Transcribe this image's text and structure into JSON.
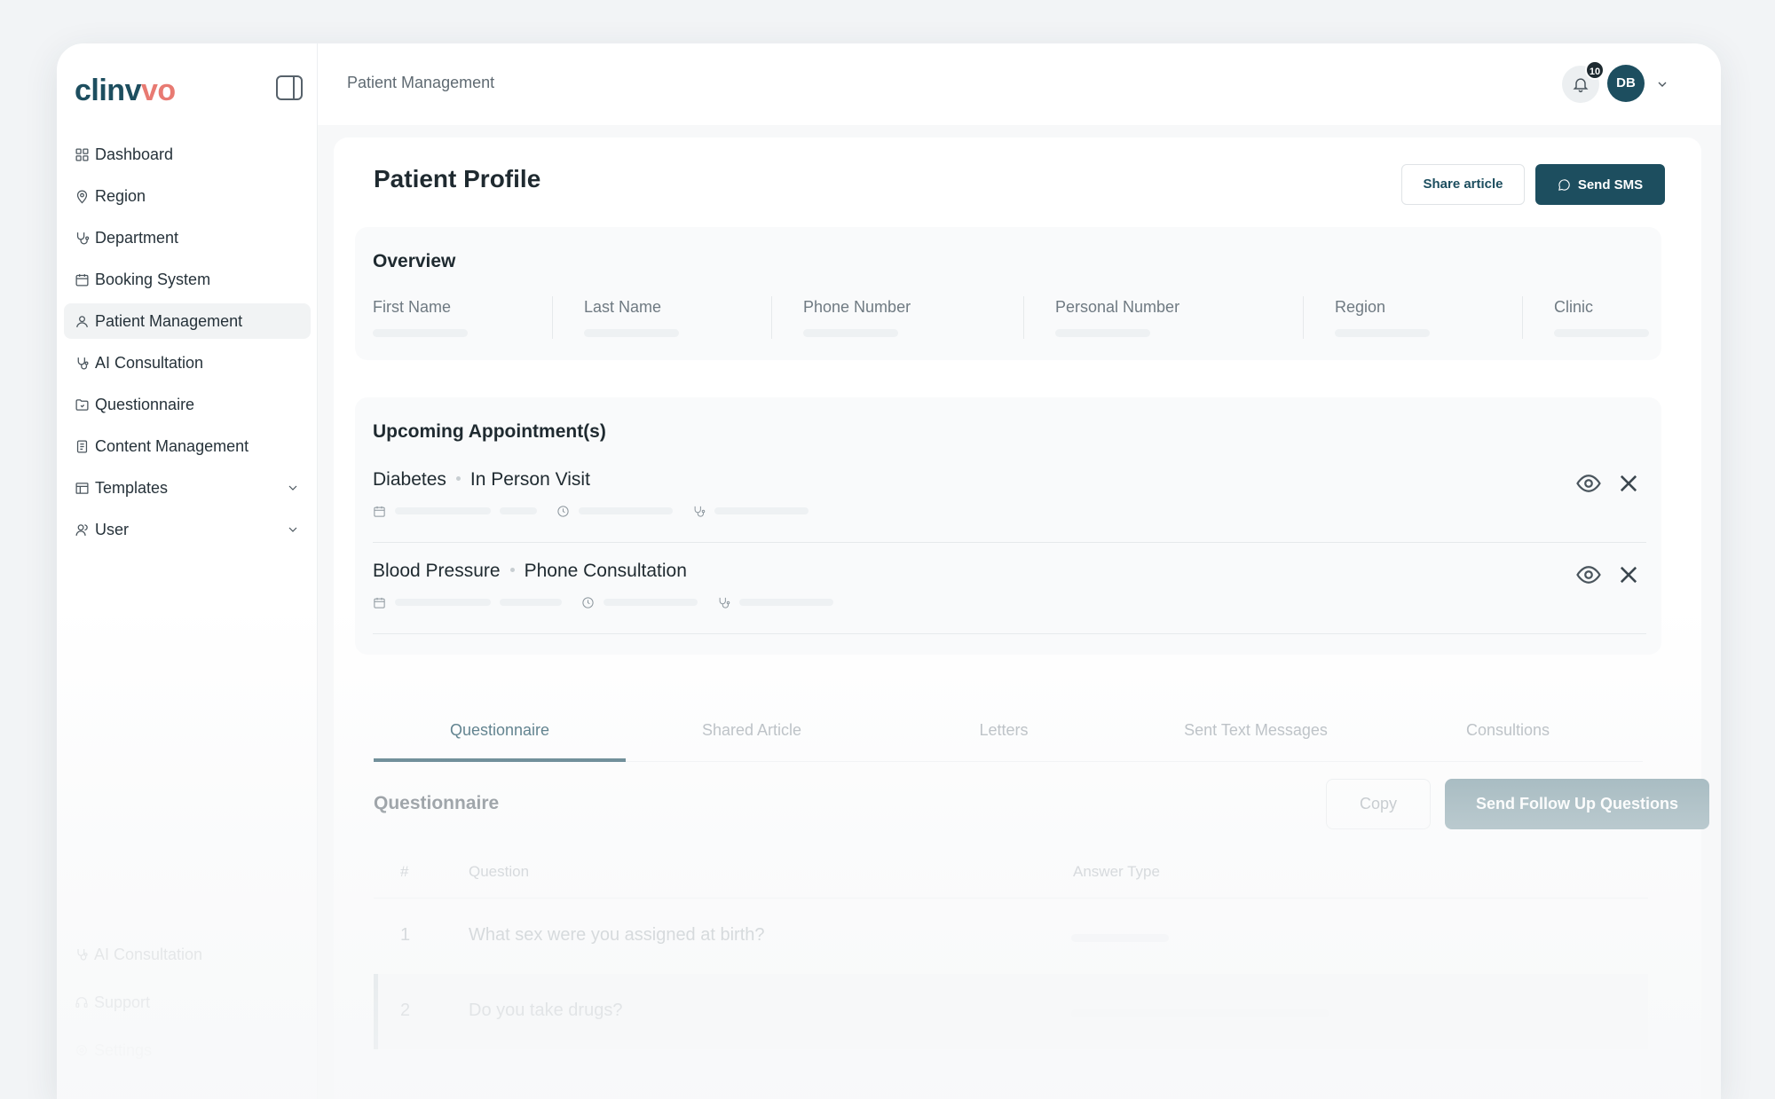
{
  "brand": {
    "logo_main": "clinv",
    "logo_accent": "vo"
  },
  "sidebar": {
    "items": [
      {
        "label": "Dashboard",
        "icon": "grid-icon"
      },
      {
        "label": "Region",
        "icon": "map-pin-icon"
      },
      {
        "label": "Department",
        "icon": "stethoscope-icon"
      },
      {
        "label": "Booking System",
        "icon": "calendar-icon"
      },
      {
        "label": "Patient Management",
        "icon": "user-icon",
        "active": true
      },
      {
        "label": "AI Consultation",
        "icon": "ai-stethoscope-icon"
      },
      {
        "label": "Questionnaire",
        "icon": "folder-icon"
      },
      {
        "label": "Content Management",
        "icon": "document-icon"
      },
      {
        "label": "Templates",
        "icon": "table-icon",
        "expandable": true
      },
      {
        "label": "User",
        "icon": "users-icon",
        "expandable": true
      }
    ],
    "bottom": [
      {
        "label": "AI Consultation",
        "icon": "ai-stethoscope-icon"
      },
      {
        "label": "Support",
        "icon": "headset-icon"
      },
      {
        "label": "Settings",
        "icon": "gear-icon"
      }
    ]
  },
  "header": {
    "breadcrumb": "Patient Management",
    "notification_count": "10",
    "avatar_initials": "DB"
  },
  "profile": {
    "title": "Patient Profile",
    "share_label": "Share article",
    "send_sms_label": "Send SMS"
  },
  "overview": {
    "title": "Overview",
    "fields": [
      "First Name",
      "Last Name",
      "Phone Number",
      "Personal Number",
      "Region",
      "Clinic"
    ]
  },
  "appointments": {
    "title": "Upcoming Appointment(s)",
    "items": [
      {
        "condition": "Diabetes",
        "type": "In Person Visit"
      },
      {
        "condition": "Blood Pressure",
        "type": "Phone Consultation"
      }
    ]
  },
  "tabs": [
    "Questionnaire",
    "Shared Article",
    "Letters",
    "Sent Text Messages",
    "Consultions"
  ],
  "questionnaire": {
    "heading": "Questionnaire",
    "copy_label": "Copy",
    "follow_up_label": "Send Follow Up Questions",
    "columns": [
      "#",
      "Question",
      "Answer Type"
    ],
    "rows": [
      {
        "num": "1",
        "question": "What sex were you assigned at birth?"
      },
      {
        "num": "2",
        "question": "Do you take drugs?"
      }
    ]
  },
  "colors": {
    "primary": "#1d4e5f",
    "accent": "#e87a72",
    "background": "#f2f4f6"
  }
}
